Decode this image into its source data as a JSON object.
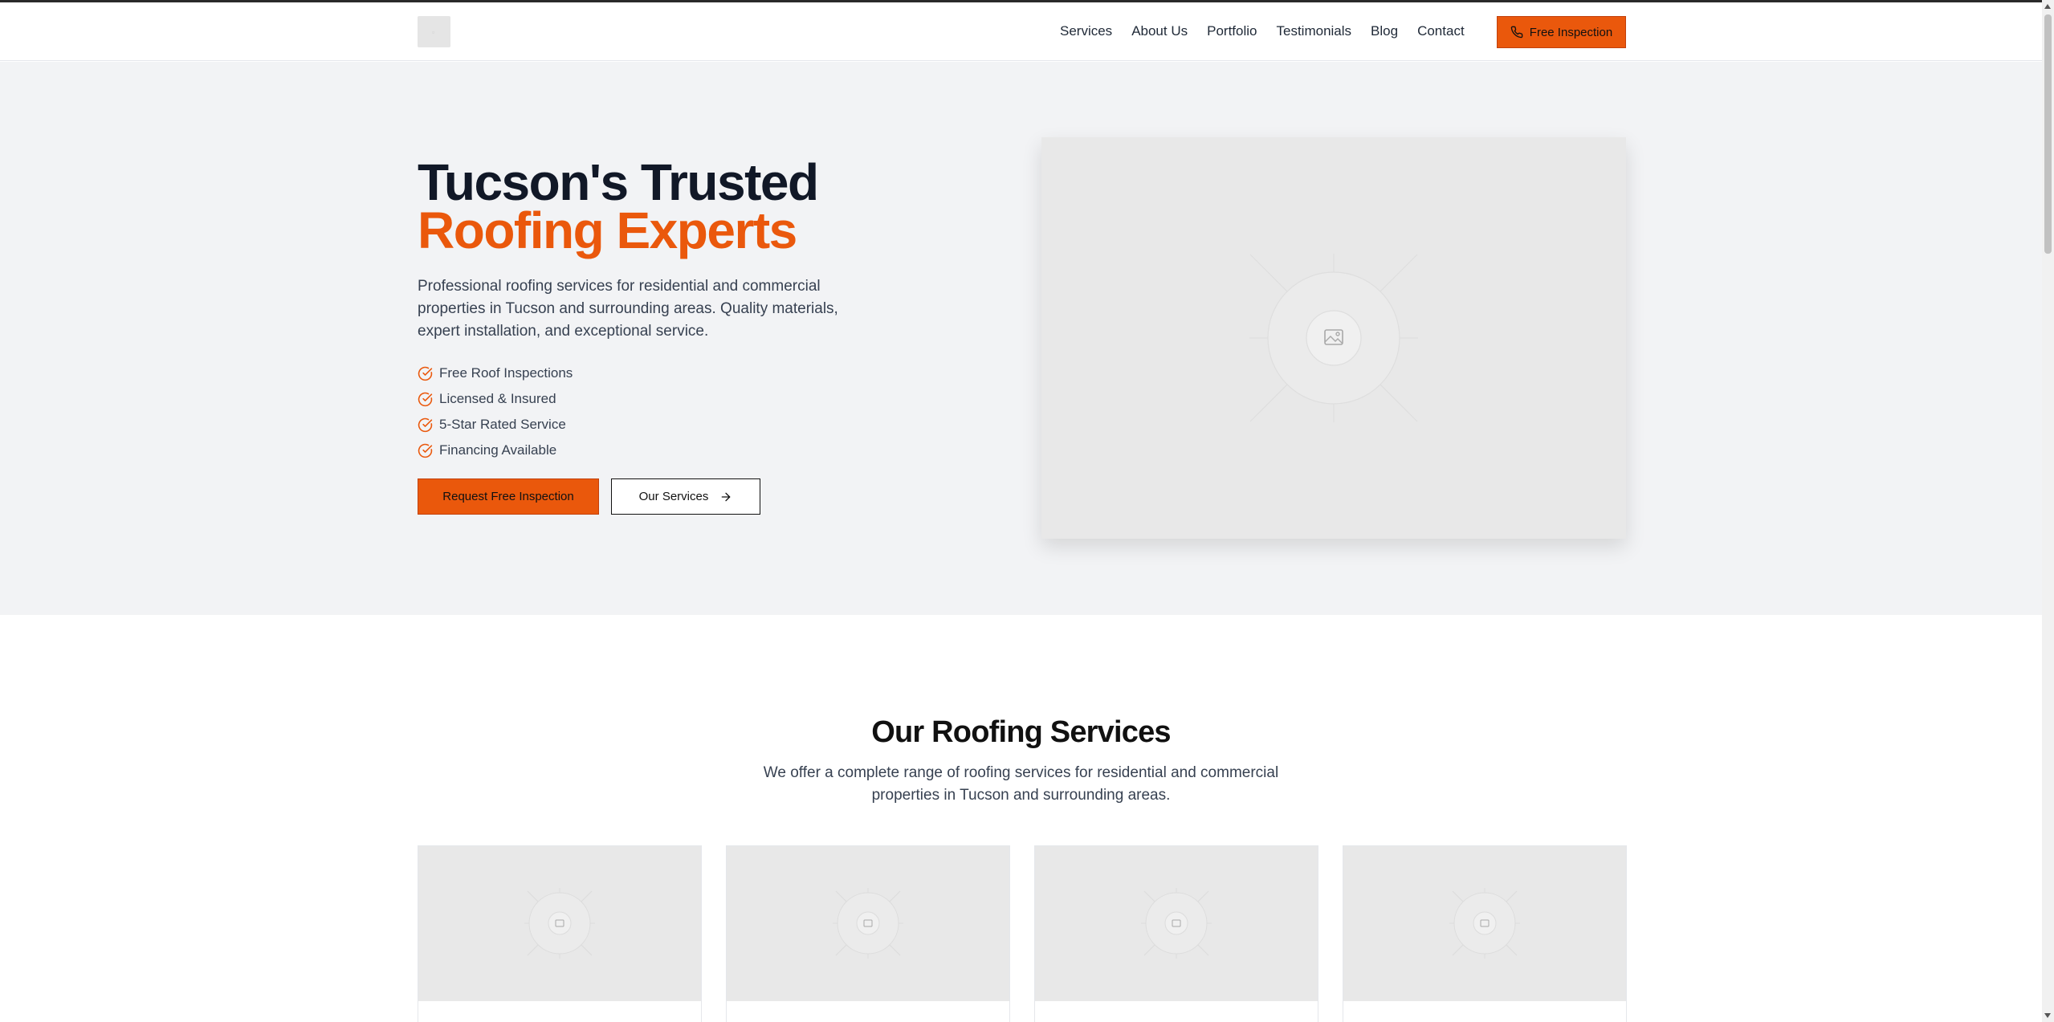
{
  "nav": {
    "items": [
      {
        "label": "Services"
      },
      {
        "label": "About Us"
      },
      {
        "label": "Portfolio"
      },
      {
        "label": "Testimonials"
      },
      {
        "label": "Blog"
      },
      {
        "label": "Contact"
      }
    ],
    "cta_label": "Free Inspection",
    "cta_icon": "phone-icon"
  },
  "hero": {
    "title_line1": "Tucson's Trusted",
    "title_line2": "Roofing Experts",
    "description": "Professional roofing services for residential and commercial properties in Tucson and surrounding areas. Quality materials, expert installation, and exceptional service.",
    "features": [
      {
        "label": "Free Roof Inspections"
      },
      {
        "label": "Licensed & Insured"
      },
      {
        "label": "5-Star Rated Service"
      },
      {
        "label": "Financing Available"
      }
    ],
    "primary_button": "Request Free Inspection",
    "secondary_button": "Our Services",
    "secondary_icon": "arrow-right-icon",
    "image_icon": "image-placeholder-icon"
  },
  "services": {
    "title": "Our Roofing Services",
    "description": "We offer a complete range of roofing services for residential and commercial properties in Tucson and surrounding areas.",
    "cards": [
      {
        "image_icon": "image-placeholder-icon"
      },
      {
        "image_icon": "image-placeholder-icon"
      },
      {
        "image_icon": "image-placeholder-icon"
      },
      {
        "image_icon": "image-placeholder-icon"
      }
    ]
  },
  "colors": {
    "accent": "#ea580c",
    "hero_bg": "#f2f3f5",
    "text_dark": "#111827",
    "text_muted": "#374151",
    "placeholder_bg": "#e8e8e8"
  }
}
